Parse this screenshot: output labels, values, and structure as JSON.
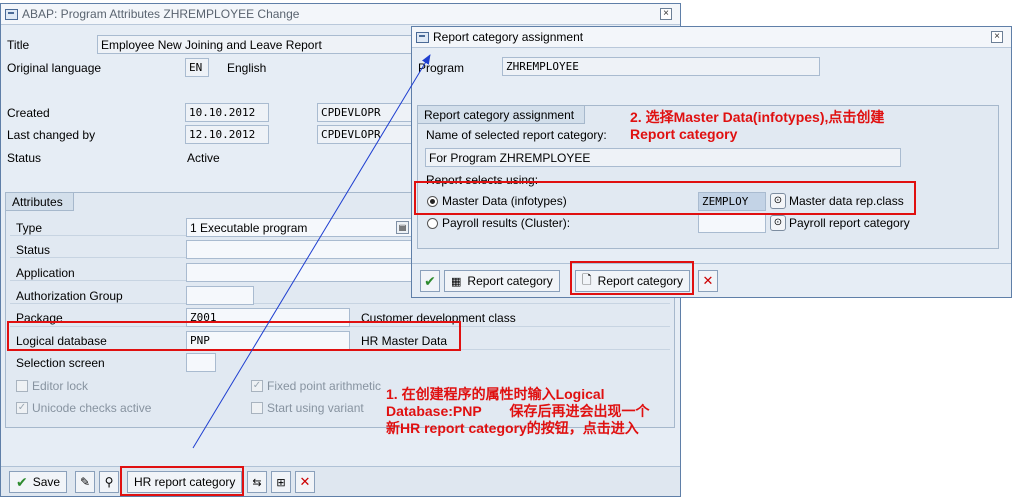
{
  "main_window": {
    "title": "ABAP: Program Attributes ZHREMPLOYEE Change",
    "title_field": {
      "label": "Title",
      "value": "Employee New Joining and Leave Report"
    },
    "original_language": {
      "label": "Original language",
      "code": "EN",
      "text": "English"
    },
    "created": {
      "label": "Created",
      "date": "10.10.2012",
      "user": "CPDEVLOPR"
    },
    "last_changed": {
      "label": "Last changed by",
      "date": "12.10.2012",
      "user": "CPDEVLOPR"
    },
    "status": {
      "label": "Status",
      "value": "Active"
    },
    "attributes": {
      "group_title": "Attributes",
      "type": {
        "label": "Type",
        "value": "1 Executable program"
      },
      "status_label": "Status",
      "application_label": "Application",
      "authorization_group_label": "Authorization Group",
      "package": {
        "label": "Package",
        "value": "Z001",
        "description": "Customer development class"
      },
      "logical_database": {
        "label": "Logical database",
        "value": "PNP",
        "description": "HR Master Data"
      },
      "selection_screen_label": "Selection screen",
      "editor_lock": "Editor lock",
      "fixed_point": "Fixed point arithmetic",
      "unicode_checks": "Unicode checks active",
      "start_variant": "Start using variant"
    },
    "toolbar": {
      "save_label": "Save",
      "hr_report_category_label": "HR report category"
    }
  },
  "dialog": {
    "title": "Report category assignment",
    "program": {
      "label": "Program",
      "value": "ZHREMPLOYEE"
    },
    "group_title": "Report category assignment",
    "selected_label": "Name of selected report category:",
    "selected_value": "For Program ZHREMPLOYEE",
    "selects_using_label": "Report selects using:",
    "master_data": {
      "label": "Master Data (infotypes)",
      "value": "ZEMPLOY",
      "description": "Master data rep.class"
    },
    "payroll": {
      "label": "Payroll results (Cluster):",
      "value": "",
      "description": "Payroll report category"
    },
    "buttons": {
      "report_category_1": "Report category",
      "report_category_2": "Report category"
    }
  },
  "annotations": {
    "step1_line1": "1. 在创建程序的属性时输入Logical",
    "step1_line2": "Database:PNP　　保存后再进会出现一个",
    "step1_line3": "新HR report category的按钮，点击进入",
    "step2_line1": "2. 选择Master Data(infotypes),点击创建",
    "step2_line2": "Report category"
  },
  "colors": {
    "annotation_red": "#e01010",
    "arrow_blue": "#1f3fd0"
  }
}
